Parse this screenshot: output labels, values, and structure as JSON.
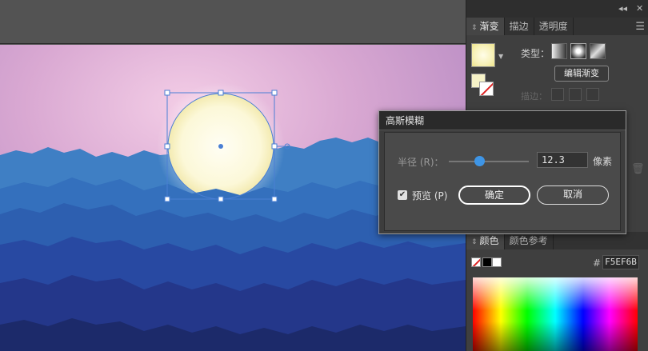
{
  "panel": {
    "tabs": [
      "渐变",
      "描边",
      "透明度"
    ],
    "active_tab": "渐变",
    "collapse_glyph": "◂◂",
    "close_glyph": "✕",
    "menu_glyph": "☰",
    "gradient": {
      "type_label": "类型：",
      "edit_button": "编辑渐变",
      "stroke_label": "描边："
    },
    "color_tabs": [
      "颜色",
      "颜色参考"
    ],
    "hex_prefix": "#",
    "hex_value": "F5EF6B"
  },
  "dialog": {
    "title": "高斯模糊",
    "radius_label": "半径 (R)：",
    "radius_value": "12.3",
    "radius_unit": "像素",
    "preview_label": "预览 (P)",
    "preview_checked": true,
    "ok_label": "确定",
    "cancel_label": "取消",
    "slider_fraction": 0.38
  },
  "colors": {
    "accent": "#3e95e6",
    "selection": "#4a7fd4",
    "sun": "#fffbe0"
  }
}
